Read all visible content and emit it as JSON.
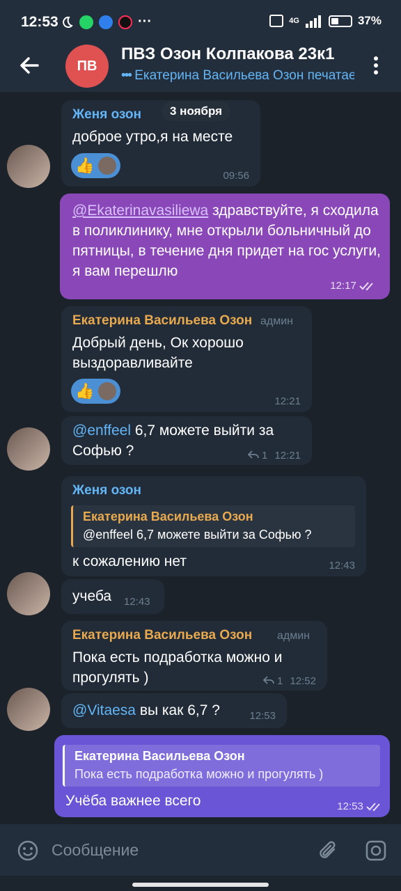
{
  "status": {
    "time": "12:53",
    "network": "4G",
    "battery_text": "37%",
    "battery_level": 0.37
  },
  "header": {
    "avatar_initials": "ПВ",
    "title": "ПВЗ Озон Колпакова 23к1",
    "subtitle": "Екатерина Васильева Озон печатает"
  },
  "date_pill": "3 ноября",
  "messages": [
    {
      "sender": "Женя озон",
      "text": "доброе утро,я на месте",
      "time": "09:56",
      "reaction": "👍"
    },
    {
      "text": "@Ekaterinavasiliewa здравствуйте, я сходила в поликлинику, мне открыли больничный до пятницы, в течение дня придет на гос услуги, я вам перешлю",
      "time": "12:17"
    },
    {
      "sender": "Екатерина Васильева Озон",
      "role": "админ",
      "text": "Добрый день, Ок хорошо выздоравливайте",
      "time": "12:21",
      "reaction": "👍"
    },
    {
      "text": "@enffeel 6,7 можете выйти за Софью ?",
      "time": "12:21",
      "replies": "1"
    },
    {
      "sender": "Женя озон",
      "quote_author": "Екатерина Васильева Озон",
      "quote_text": "@enffeel 6,7 можете выйти за Софью ?",
      "text": "к сожалению нет",
      "time": "12:43"
    },
    {
      "text": "учеба",
      "time": "12:43"
    },
    {
      "sender": "Екатерина Васильева Озон",
      "role": "админ",
      "text": "Пока есть подработка можно и прогулять )",
      "time": "12:52",
      "replies": "1"
    },
    {
      "text": "@Vitaesa вы как 6,7 ?",
      "time": "12:53"
    },
    {
      "quote_author": "Екатерина Васильева Озон",
      "quote_text": "Пока есть подработка можно и прогулять )",
      "text": "Учёба важнее всего",
      "time": "12:53"
    }
  ],
  "composer": {
    "placeholder": "Сообщение"
  },
  "colors": {
    "header_bg": "#232e3c",
    "chat_bg": "#1b222a",
    "incoming": "#212c38",
    "outgoing": "#8a47b7",
    "outgoing_alt": "#6a55d6",
    "sender_blue": "#64b5f6",
    "sender_orange": "#e8a94f",
    "link": "#64b5f6"
  }
}
